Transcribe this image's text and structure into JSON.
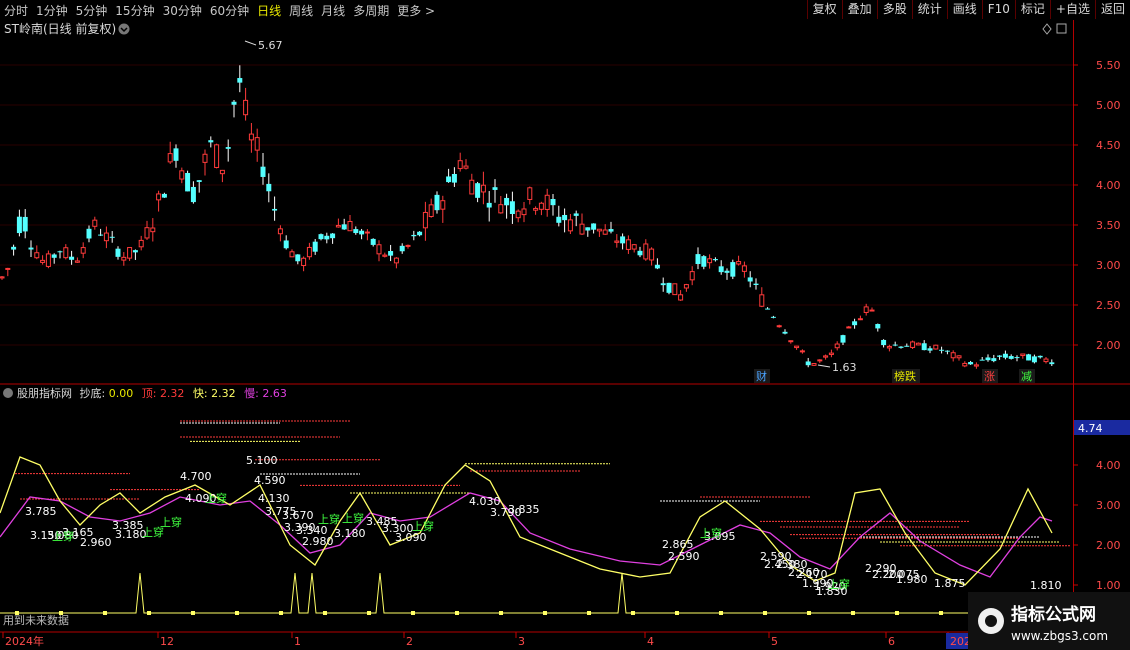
{
  "toolbar": {
    "periods": [
      "分时",
      "1分钟",
      "5分钟",
      "15分钟",
      "30分钟",
      "60分钟",
      "日线",
      "周线",
      "月线",
      "多周期",
      "更多 >"
    ],
    "active_period": "日线",
    "actions": [
      "复权",
      "叠加",
      "多股",
      "统计",
      "画线",
      "F10",
      "标记",
      "+自选",
      "返回"
    ]
  },
  "main": {
    "title": "ST岭南(日线 前复权)",
    "y_ticks": [
      "5.50",
      "5.00",
      "4.50",
      "4.00",
      "3.50",
      "3.00",
      "2.50",
      "2.00"
    ],
    "high_label": "5.67",
    "low_label": "1.63",
    "event_tags": [
      {
        "text": "财",
        "color": "#4aa3ff"
      },
      {
        "text": "榜跌",
        "color": "#e8e800"
      },
      {
        "text": "涨",
        "color": "#ff4040"
      },
      {
        "text": "减",
        "color": "#40ff40"
      }
    ]
  },
  "indicator": {
    "name": "股朋指标网",
    "chaodi_label": "抄底:",
    "chaodi_value": "0.00",
    "ding_label": "顶:",
    "ding_value": "2.32",
    "kuai_label": "快:",
    "kuai_value": "2.32",
    "man_label": "慢:",
    "man_value": "2.63",
    "y_ticks": [
      "4.00",
      "3.00",
      "2.00",
      "1.00"
    ],
    "current_value": "4.74",
    "level_labels": [
      "3.785",
      "3.150",
      "3.080",
      "3.165",
      "2.960",
      "3.385",
      "3.180",
      "4.700",
      "5.100",
      "4.590",
      "4.090",
      "4.130",
      "3.775",
      "3.670",
      "3.390",
      "3.340",
      "2.980",
      "3.180",
      "3.485",
      "3.300",
      "3.090",
      "4.030",
      "3.790",
      "3.835",
      "2.865",
      "2.590",
      "3.095",
      "2.590",
      "2.450",
      "2.380",
      "2.260",
      "2.170",
      "1.990",
      "1.920",
      "1.830",
      "2.290",
      "2.200",
      "2.075",
      "1.980",
      "1.875",
      "1.810"
    ],
    "signal_label": "上穿",
    "note": "用到未来数据"
  },
  "time_axis": [
    "2024年",
    "12",
    "1",
    "2",
    "3",
    "4",
    "5",
    "6",
    "2025"
  ],
  "watermark": {
    "title": "指标公式网",
    "url": "www.zbgs3.com"
  },
  "colors": {
    "up": "#ff3b3b",
    "down": "#54ffff",
    "fast": "#ffff66",
    "slow": "#e040e0",
    "grid": "#6a0000",
    "axis": "#c80000"
  }
}
